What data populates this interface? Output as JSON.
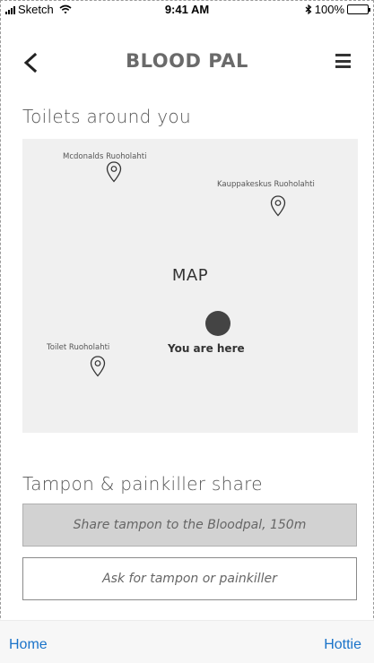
{
  "status_bar": {
    "carrier": "Sketch",
    "time": "9:41 AM",
    "battery": "100%"
  },
  "nav": {
    "title": "BLOOD PAL"
  },
  "toilets": {
    "title": "Toilets around you",
    "map_label": "MAP",
    "you_are_here": "You are here",
    "places": [
      {
        "name": "Mcdonalds Ruoholahti"
      },
      {
        "name": "Kauppakeskus Ruoholahti"
      },
      {
        "name": "Toilet Ruoholahti"
      }
    ]
  },
  "share": {
    "title": "Tampon & painkiller share",
    "share_button": "Share tampon to the Bloodpal, 150m",
    "ask_button": "Ask for tampon or painkiller"
  },
  "tabbar": {
    "home": "Home",
    "hottie": "Hottie"
  },
  "colors": {
    "link": "#1a73c9",
    "map_bg": "#f0f0f0",
    "share_bg": "#d2d2d2"
  }
}
